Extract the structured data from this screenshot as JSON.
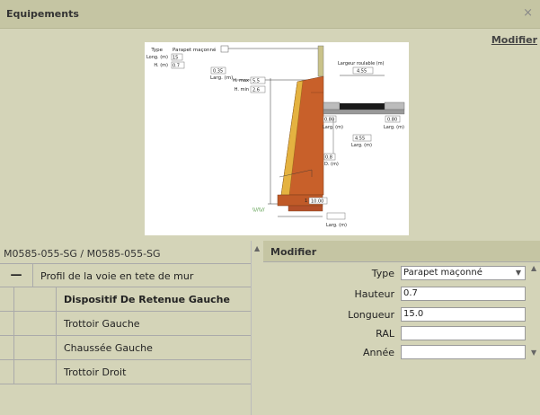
{
  "window": {
    "title": "Equipements",
    "close": "×"
  },
  "top": {
    "modify_link": "Modifier"
  },
  "diagram": {
    "type_label": "Type",
    "type_value": "Parapet maçonné",
    "long_label": "Long. (m)",
    "long_value": "15",
    "h_label": "H. (m)",
    "h_value": "0.7",
    "larg_small": "0.35",
    "larg_label": "Larg. (m)",
    "hmax_label": "H. max",
    "hmax_value": "5.5",
    "hmin_label": "H. min",
    "hmin_value": "2.6",
    "largeur_roulable_label": "Largeur roulable (m)",
    "largeur_roulable_value": "4.55",
    "left_trottoir": "0.80",
    "right_trottoir": "0.80",
    "larg_m": "Larg. (m)",
    "mid_value": "4.55",
    "mid_larg": "Larg. (m)",
    "d_value": "0.8",
    "d_label": "D. (m)",
    "slope_value": "1",
    "slope_ratio": "10.00",
    "ground_text": "\\\\//\\\\//",
    "bottom_larg": "Larg. (m)"
  },
  "left": {
    "header": "M0585-055-SG / M0585-055-SG",
    "group_toggle": "—",
    "group_label": "Profil de la voie en tete de mur",
    "items": [
      {
        "label": "Dispositif De Retenue Gauche"
      },
      {
        "label": "Trottoir Gauche"
      },
      {
        "label": "Chaussée Gauche"
      },
      {
        "label": "Trottoir Droit"
      }
    ]
  },
  "right": {
    "header": "Modifier",
    "fields": {
      "type_label": "Type",
      "type_value": "Parapet maçonné",
      "hauteur_label": "Hauteur",
      "hauteur_value": "0.7",
      "longueur_label": "Longueur",
      "longueur_value": "15.0",
      "ral_label": "RAL",
      "ral_value": "",
      "annee_label": "Année",
      "annee_value": ""
    }
  },
  "icons": {
    "splitter_up": "▲",
    "scroll_up": "▲",
    "scroll_down": "▼",
    "select_caret": "▼"
  }
}
